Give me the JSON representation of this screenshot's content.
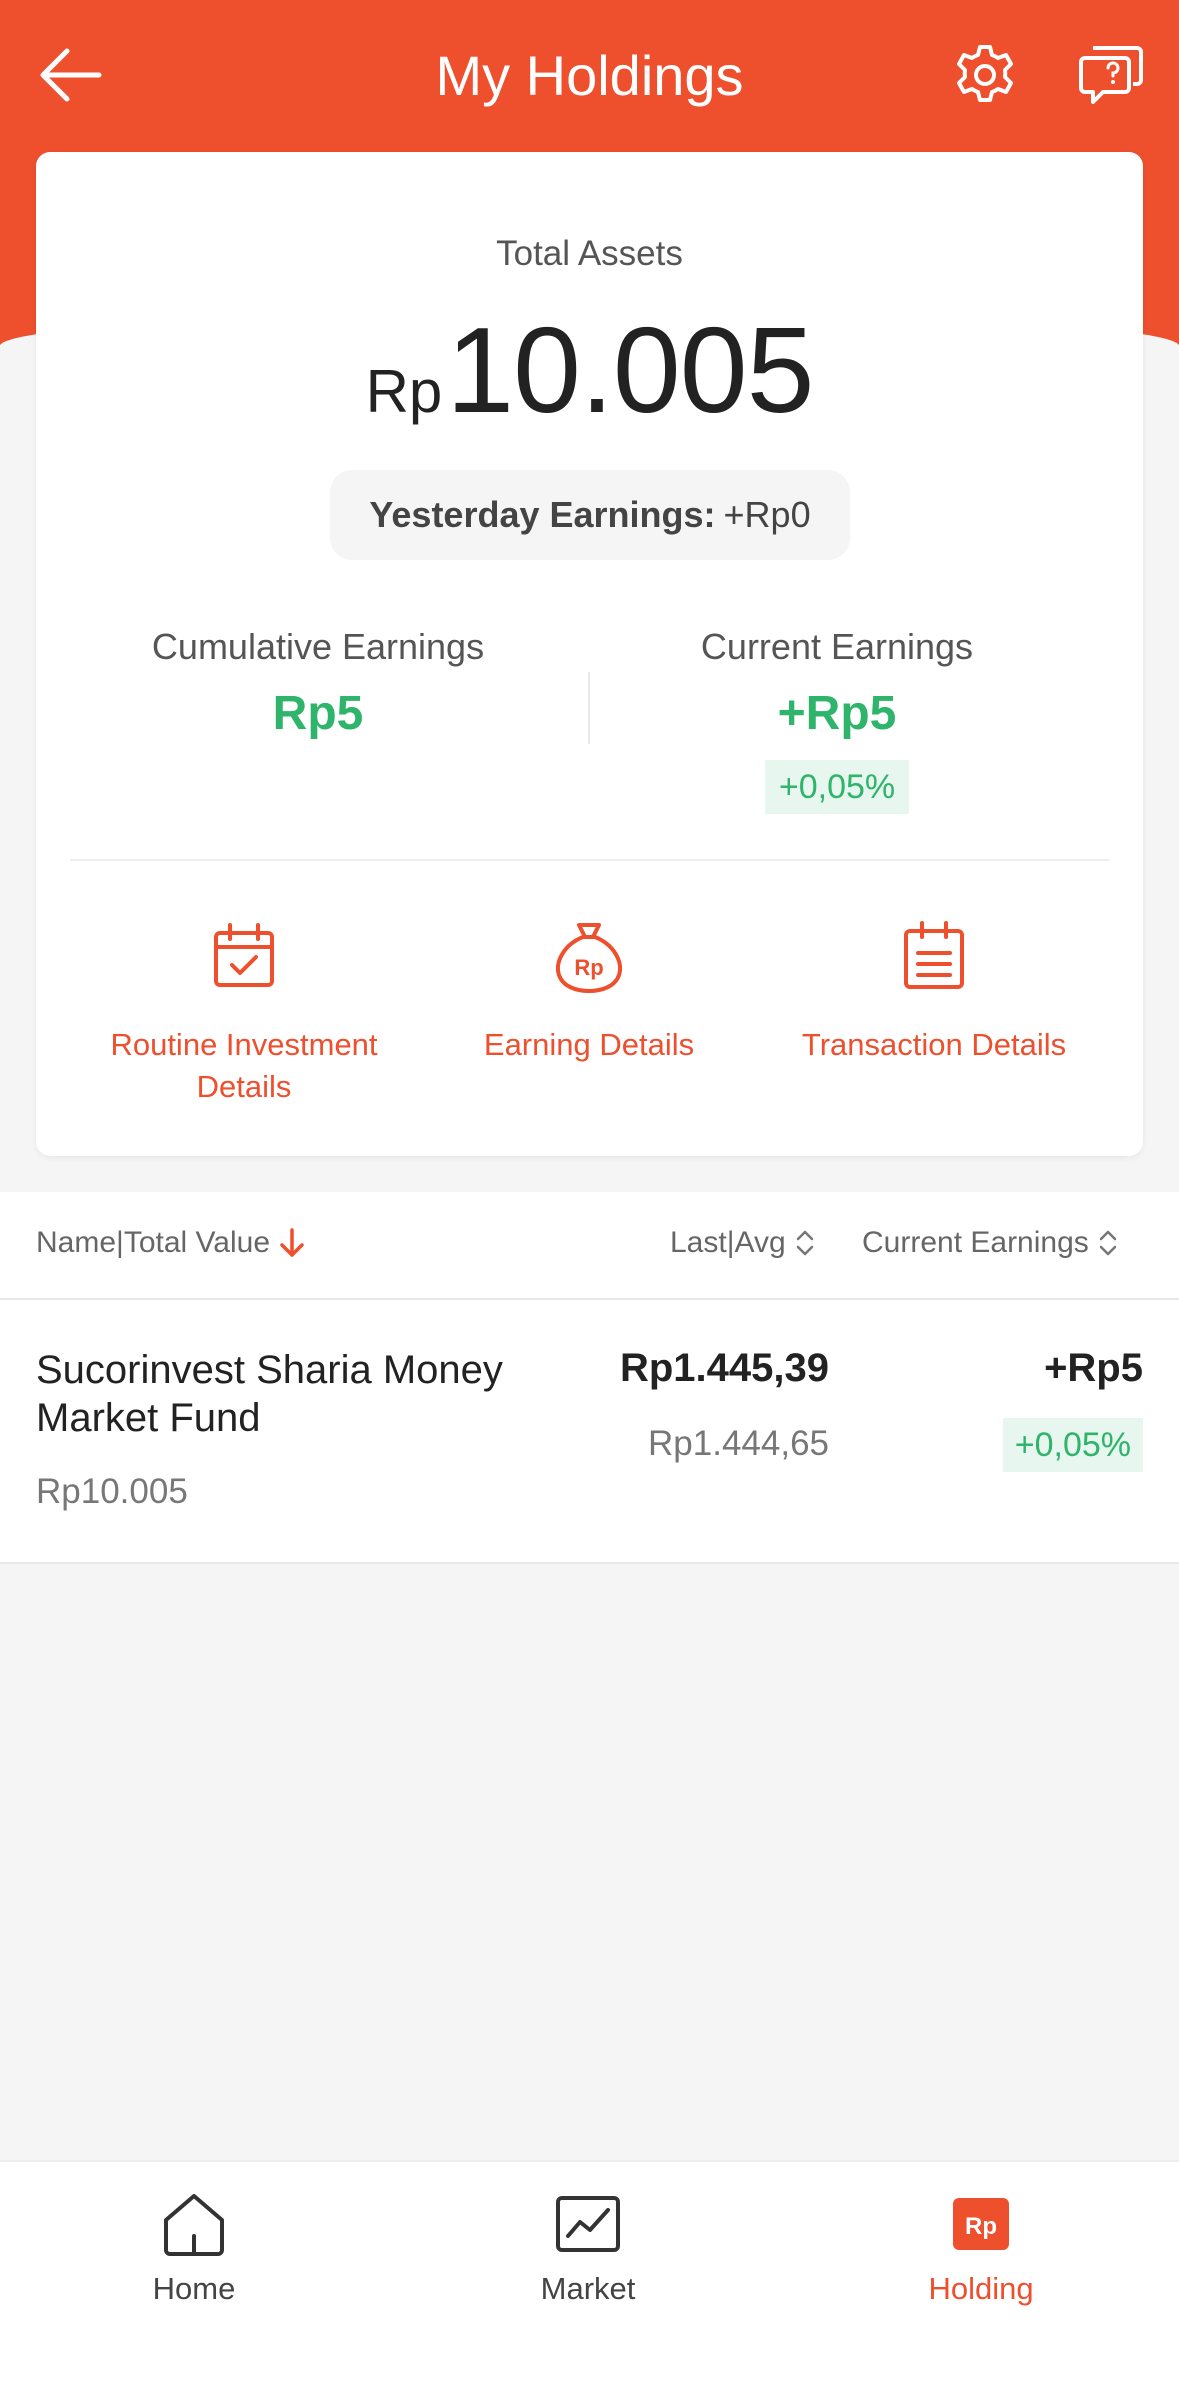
{
  "header": {
    "title": "My Holdings",
    "back_icon": "arrow-left-icon",
    "settings_icon": "gear-icon",
    "help_icon": "chat-question-icon",
    "color": "#ee4f2d"
  },
  "summary": {
    "total_label": "Total Assets",
    "total_currency": "Rp",
    "total_value": "10.005",
    "yesterday_label": "Yesterday Earnings:",
    "yesterday_value": "+Rp0",
    "cumulative_label": "Cumulative Earnings",
    "cumulative_value": "Rp5",
    "current_label": "Current Earnings",
    "current_value": "+Rp5",
    "current_pct": "+0,05%"
  },
  "quick_actions": [
    {
      "label": "Routine Investment Details",
      "icon": "calendar-check-icon"
    },
    {
      "label": "Earning Details",
      "icon": "money-bag-icon"
    },
    {
      "label": "Transaction Details",
      "icon": "document-list-icon"
    }
  ],
  "list": {
    "col_name": "Name|Total Value",
    "col_last": "Last|Avg",
    "col_current": "Current Earnings",
    "rows": [
      {
        "name": "Sucorinvest Sharia Money Market Fund",
        "total": "Rp10.005",
        "last": "Rp1.445,39",
        "avg": "Rp1.444,65",
        "earn": "+Rp5",
        "pct": "+0,05%"
      }
    ]
  },
  "tabs": [
    {
      "label": "Home",
      "icon": "home-icon"
    },
    {
      "label": "Market",
      "icon": "chart-icon"
    },
    {
      "label": "Holding",
      "icon": "rp-holding-icon",
      "active": true
    }
  ],
  "colors": {
    "accent": "#ee4f2d",
    "positive": "#2eb46b"
  }
}
